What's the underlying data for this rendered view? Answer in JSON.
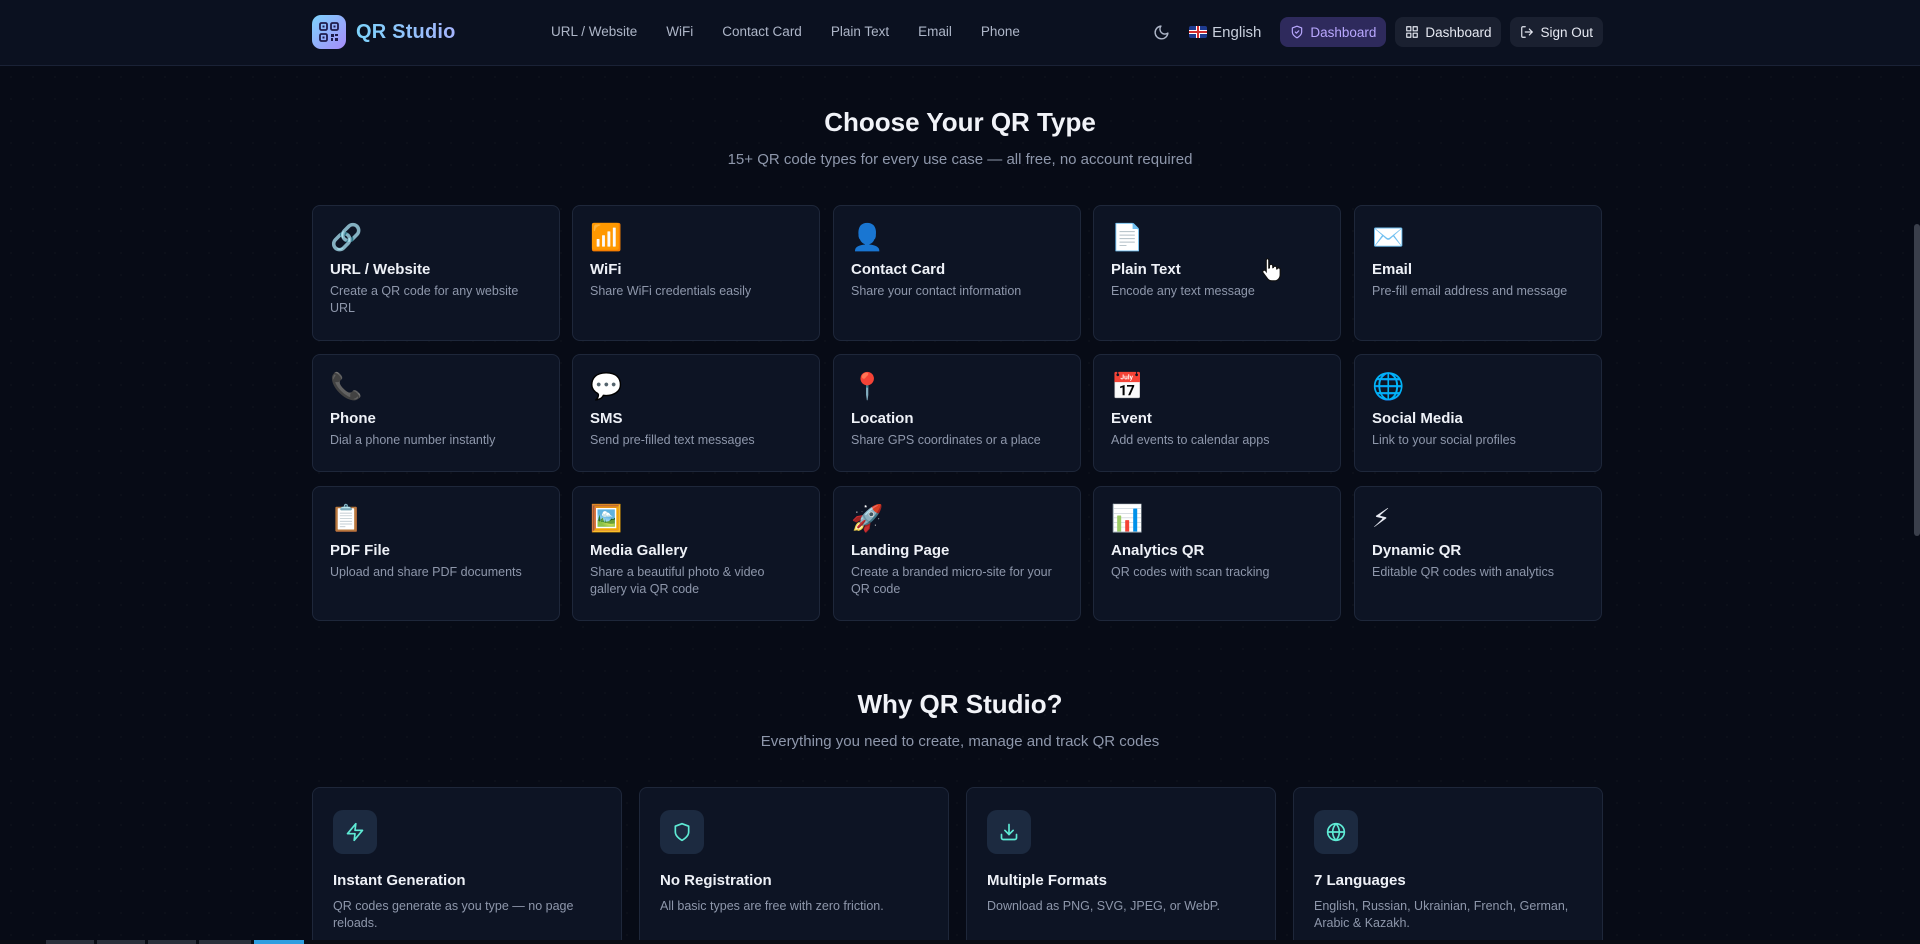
{
  "header": {
    "brand": "QR Studio",
    "nav": [
      "URL / Website",
      "WiFi",
      "Contact Card",
      "Plain Text",
      "Email",
      "Phone"
    ],
    "language": "English",
    "admin_label": "Dashboard",
    "dashboard_label": "Dashboard",
    "signout_label": "Sign Out"
  },
  "types_section": {
    "title": "Choose Your QR Type",
    "subtitle": "15+ QR code types for every use case — all free, no account required",
    "cards": [
      {
        "icon": "🔗",
        "icon_name": "link-icon",
        "title": "URL / Website",
        "desc": "Create a QR code for any website URL"
      },
      {
        "icon": "📶",
        "icon_name": "wifi-icon",
        "title": "WiFi",
        "desc": "Share WiFi credentials easily"
      },
      {
        "icon": "👤",
        "icon_name": "person-icon",
        "title": "Contact Card",
        "desc": "Share your contact information"
      },
      {
        "icon": "📄",
        "icon_name": "document-icon",
        "title": "Plain Text",
        "desc": "Encode any text message"
      },
      {
        "icon": "✉️",
        "icon_name": "envelope-icon",
        "title": "Email",
        "desc": "Pre-fill email address and message"
      },
      {
        "icon": "📞",
        "icon_name": "phone-icon",
        "title": "Phone",
        "desc": "Dial a phone number instantly"
      },
      {
        "icon": "💬",
        "icon_name": "chat-bubble-icon",
        "title": "SMS",
        "desc": "Send pre-filled text messages"
      },
      {
        "icon": "📍",
        "icon_name": "pin-icon",
        "title": "Location",
        "desc": "Share GPS coordinates or a place"
      },
      {
        "icon": "📅",
        "icon_name": "calendar-icon",
        "title": "Event",
        "desc": "Add events to calendar apps"
      },
      {
        "icon": "🌐",
        "icon_name": "globe-icon",
        "title": "Social Media",
        "desc": "Link to your social profiles"
      },
      {
        "icon": "📋",
        "icon_name": "clipboard-icon",
        "title": "PDF File",
        "desc": "Upload and share PDF documents"
      },
      {
        "icon": "🖼️",
        "icon_name": "picture-icon",
        "title": "Media Gallery",
        "desc": "Share a beautiful photo & video gallery via QR code"
      },
      {
        "icon": "🚀",
        "icon_name": "rocket-icon",
        "title": "Landing Page",
        "desc": "Create a branded micro-site for your QR code"
      },
      {
        "icon": "📊",
        "icon_name": "bar-chart-icon",
        "title": "Analytics QR",
        "desc": "QR codes with scan tracking"
      },
      {
        "icon": "⚡",
        "icon_name": "lightning-icon",
        "title": "Dynamic QR",
        "desc": "Editable QR codes with analytics"
      }
    ]
  },
  "why_section": {
    "title": "Why QR Studio?",
    "subtitle": "Everything you need to create, manage and track QR codes",
    "features": [
      {
        "icon_name": "lightning-icon",
        "title": "Instant Generation",
        "desc": "QR codes generate as you type — no page reloads."
      },
      {
        "icon_name": "shield-icon",
        "title": "No Registration",
        "desc": "All basic types are free with zero friction."
      },
      {
        "icon_name": "download-icon",
        "title": "Multiple Formats",
        "desc": "Download as PNG, SVG, JPEG, or WebP."
      },
      {
        "icon_name": "globe-icon",
        "title": "7 Languages",
        "desc": "English, Russian, Ukrainian, French, German, Arabic & Kazakh."
      }
    ]
  },
  "colors": {
    "background": "#070b16",
    "card": "#0d1424",
    "accent": "#7dd3fc",
    "admin_accent": "#b9a8ff"
  }
}
